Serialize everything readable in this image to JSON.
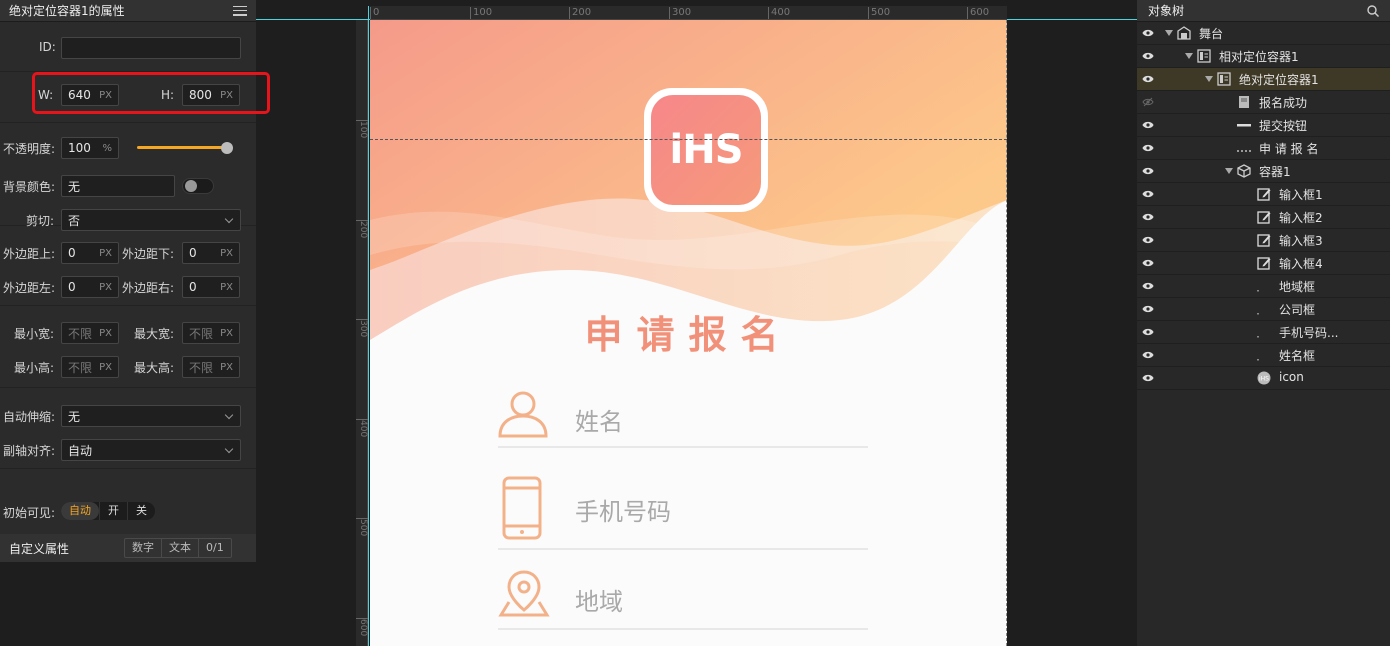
{
  "properties_panel": {
    "title": "绝对定位容器1的属性",
    "id_label": "ID:",
    "id_value": "",
    "w_label": "W:",
    "w_value": "640",
    "h_label": "H:",
    "h_value": "800",
    "unit_px": "PX",
    "opacity_label": "不透明度:",
    "opacity_value": "100",
    "opacity_unit": "%",
    "bg_color_label": "背景颜色:",
    "bg_color_value": "无",
    "clip_label": "剪切:",
    "clip_value": "否",
    "margin_top_label": "外边距上:",
    "margin_top_value": "0",
    "margin_bottom_label": "外边距下:",
    "margin_bottom_value": "0",
    "margin_left_label": "外边距左:",
    "margin_left_value": "0",
    "margin_right_label": "外边距右:",
    "margin_right_value": "0",
    "min_w_label": "最小宽:",
    "min_w_value": "不限",
    "max_w_label": "最大宽:",
    "max_w_value": "不限",
    "min_h_label": "最小高:",
    "min_h_value": "不限",
    "max_h_label": "最大高:",
    "max_h_value": "不限",
    "auto_stretch_label": "自动伸缩:",
    "auto_stretch_value": "无",
    "cross_align_label": "副轴对齐:",
    "cross_align_value": "自动",
    "initial_visible_label": "初始可见:",
    "visible_options": [
      "自动",
      "开",
      "关"
    ],
    "custom_attr_label": "自定义属性",
    "custom_tabs": [
      "数字",
      "文本",
      "0/1"
    ]
  },
  "ruler_h": [
    "0",
    "100",
    "200",
    "300",
    "400",
    "500",
    "600"
  ],
  "ruler_v": [
    "100",
    "200",
    "300",
    "400",
    "500",
    "600"
  ],
  "canvas": {
    "logo_text": "iHS",
    "form_title": "申请报名",
    "fields": [
      "姓名",
      "手机号码",
      "地域"
    ]
  },
  "tree_panel": {
    "title": "对象树",
    "nodes": [
      {
        "label": "舞台",
        "icon": "stage-icon"
      },
      {
        "label": "相对定位容器1",
        "icon": "relative-container-icon"
      },
      {
        "label": "绝对定位容器1",
        "icon": "absolute-container-icon"
      },
      {
        "label": "报名成功",
        "icon": "image-icon"
      },
      {
        "label": "提交按钮",
        "icon": "button-icon"
      },
      {
        "label": "申 请 报 名",
        "icon": "text-icon"
      },
      {
        "label": "容器1",
        "icon": "box-icon"
      },
      {
        "label": "输入框1",
        "icon": "edit-icon"
      },
      {
        "label": "输入框2",
        "icon": "edit-icon"
      },
      {
        "label": "输入框3",
        "icon": "edit-icon"
      },
      {
        "label": "输入框4",
        "icon": "edit-icon"
      },
      {
        "label": "地域框",
        "icon": "field-icon"
      },
      {
        "label": "公司框",
        "icon": "field-icon"
      },
      {
        "label": "手机号码...",
        "icon": "field-icon"
      },
      {
        "label": "姓名框",
        "icon": "field-icon"
      },
      {
        "label": "icon",
        "icon": "thumb-icon"
      }
    ]
  },
  "colors": {
    "accent": "#f5a623",
    "highlight": "#e8141c",
    "title": "#f2917a"
  }
}
